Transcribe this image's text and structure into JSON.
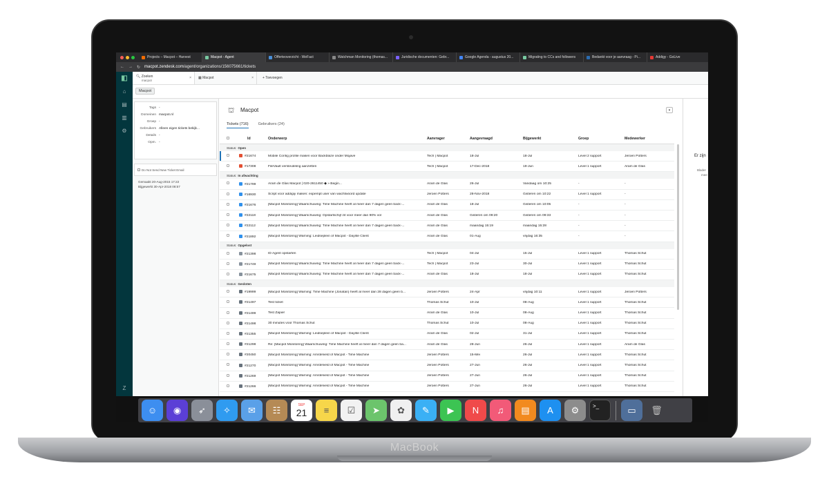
{
  "device": {
    "brand": "MacBook"
  },
  "browser": {
    "tabs": [
      {
        "label": "Projects – Macpot – Harvest",
        "color": "#f36c00"
      },
      {
        "label": "Macpot - Agent",
        "color": "#78c9a1",
        "active": true
      },
      {
        "label": "Offerteoverzicht - WeFact",
        "color": "#4a90d9"
      },
      {
        "label": "Watchman Monitoring (thomas...",
        "color": "#888888"
      },
      {
        "label": "Juridische documenten: Gebr...",
        "color": "#7b61ff"
      },
      {
        "label": "Google Agenda - augustus 20...",
        "color": "#4285f4"
      },
      {
        "label": "Migrating to CCs and followers",
        "color": "#78c9a1"
      },
      {
        "label": "Bedankt voor je aanvraag - Pi...",
        "color": "#2b6cb0"
      },
      {
        "label": "Addigy - GoLive",
        "color": "#e53935"
      }
    ],
    "address_host": "macpot.zendesk.com",
    "address_path": "/agent/organizations/156075661/tickets"
  },
  "zendesk": {
    "tabs": [
      {
        "title": "Zoeken",
        "sub": "macpot"
      },
      {
        "title": "Macpot",
        "sub": ""
      }
    ],
    "add_tab": "+ Toevoegen",
    "breadcrumb": "Macpot",
    "org": {
      "fields": [
        {
          "key": "Tags",
          "value": "-"
        },
        {
          "key": "Domeinen",
          "value": "macpot.nl"
        },
        {
          "key": "Groep",
          "value": "-"
        },
        {
          "key": "Gebruikers",
          "value": "Alleen eigen tickets bekijk..."
        },
        {
          "key": "Details",
          "value": "-"
        },
        {
          "key": "Opm.",
          "value": "-"
        }
      ],
      "checkbox_label": "Do Not Send New Ticket Email",
      "created": "Gemaakt  20-Aug-2015 17:22",
      "updated": "Bijgewerkt  30-Apr-2018 08:57"
    },
    "title": "Macpot",
    "subtabs": [
      "Tickets (716)",
      "Gebruikers (24)"
    ],
    "columns": [
      "Id",
      "Onderwerp",
      "Aanvrager",
      "Aangevraagd",
      "Bijgewerkt",
      "Groep",
      "Medewerker"
    ],
    "status_prefix": "Status:",
    "groups": [
      {
        "status": "Open",
        "color": "#e34f32",
        "rows": [
          [
            "#21674",
            "Mobile Config profile maken voor Backblaze onder Mojave",
            "Tech | Macpot",
            "18-Jul",
            "18-Jul",
            "Level 2 support",
            "Jeroen Potters"
          ],
          [
            "#17308",
            "FileVault versleuteling aanzetten",
            "Tech | Macpot",
            "17-Dec-2018",
            "19-Jun",
            "Level 1 support",
            "Aram de Glas"
          ]
        ]
      },
      {
        "status": "In afwachting",
        "color": "#3091ec",
        "rows": [
          [
            "#21799",
            "Aram de Glas Macpot | 020-2611450 ◆ » Begin...",
            "Aram de Glas",
            "26-Jul",
            "Vandaag om 10:25",
            "-",
            "-"
          ],
          [
            "#16930",
            "Script voor addigiy maken: expempt user van wachtwoord update",
            "Jeroen Potters",
            "28-Nov-2018",
            "Gisteren om 10:22",
            "Level 1 support",
            "-"
          ],
          [
            "#21676",
            "[Macpot Monitoring] Waarschuwing: Time Machine heeft al meer dan 7 dagen geen back-...",
            "Aram de Glas",
            "18-Jul",
            "Gisteren om 10:05",
            "-",
            "-"
          ],
          [
            "#22118",
            "[Macpot Monitoring] Waarschuwing: Opstartschijf zit voor meer dan 90% vol",
            "Aram de Glas",
            "Gisteren om 09:20",
            "Gisteren om 09:33",
            "-",
            "-"
          ],
          [
            "#22112",
            "[Macpot Monitoring] Waarschuwing: Time Machine heeft al meer dan 7 dagen geen back-...",
            "Aram de Glas",
            "maandag 15:19",
            "maandag 15:28",
            "-",
            "-"
          ],
          [
            "#21892",
            "[Macpot Monitoring] Warning: Leidseplein of Macpot - Daylite Client",
            "Aram de Glas",
            "01-Aug",
            "vrijdag 16:35",
            "-",
            "-"
          ]
        ]
      },
      {
        "status": "Opgelost",
        "color": "#87929d",
        "rows": [
          [
            "#21398",
            "ID Agent opstarten",
            "Tech | Macpot",
            "04-Jul",
            "15-Jul",
            "Level 1 support",
            "Thomas Schut"
          ],
          [
            "#21749",
            "[Macpot Monitoring] Waarschuwing: Time Machine heeft al meer dan 7 dagen geen back-...",
            "Tech | Macpot",
            "23-Jul",
            "30-Jul",
            "Level 1 support",
            "Thomas Schut"
          ],
          [
            "#21675",
            "[Macpot Monitoring] Waarschuwing: Time Machine heeft al meer dan 7 dagen geen back-...",
            "Aram de Glas",
            "18-Jul",
            "18-Jul",
            "Level 1 support",
            "Thomas Schut"
          ]
        ]
      },
      {
        "status": "Gesloten",
        "color": "#68737d",
        "rows": [
          [
            "#19999",
            "[Macpot Monitoring] Warning: Time Machine (Jonatan) heeft al meer dan 28 dagen geen b...",
            "Jeroen Potters",
            "24-Apr",
            "vrijdag 10:11",
            "Level 1 support",
            "Jeroen Potters"
          ],
          [
            "#21497",
            "Test ticket",
            "Thomas Schut",
            "10-Jul",
            "08-Aug",
            "Level 1 support",
            "Thomas Schut"
          ],
          [
            "#21499",
            "Test Zapier",
            "Aram de Glas",
            "10-Jul",
            "08-Aug",
            "Level 1 support",
            "Thomas Schut"
          ],
          [
            "#21498",
            "30 minutes voor Thomas Schut",
            "Thomas Schut",
            "10-Jul",
            "08-Aug",
            "Level 1 support",
            "Thomas Schut"
          ],
          [
            "#21355",
            "[Macpot Monitoring] Warning: Leidseplein of Macpot - Daylite Client",
            "Aram de Glas",
            "02-Jul",
            "31-Jul",
            "Level 1 support",
            "Thomas Schut"
          ],
          [
            "#21298",
            "Re: [Macpot Monitoring] Waarschuwing: Time Machine heeft al meer dan 7 dagen geen ba...",
            "Aram de Glas",
            "28-Jun",
            "26-Jul",
            "Level 1 support",
            "Aram de Glas"
          ],
          [
            "#20450",
            "[Macpot Monitoring] Warning: Amstelveld of Macpot - Time Machine",
            "Jeroen Potters",
            "15-Mei",
            "26-Jul",
            "Level 1 support",
            "Thomas Schut"
          ],
          [
            "#21270",
            "[Macpot Monitoring] Warning: Amstelveld of Macpot - Time Machine",
            "Jeroen Potters",
            "27-Jun",
            "26-Jul",
            "Level 1 support",
            "Thomas Schut"
          ],
          [
            "#21269",
            "[Macpot Monitoring] Warning: Amstelveld of Macpot - Time Machine",
            "Jeroen Potters",
            "27-Jun",
            "26-Jul",
            "Level 1 support",
            "Thomas Schut"
          ],
          [
            "#21266",
            "[Macpot Monitoring] Warning: Amstelveld of Macpot - Time Machine",
            "Jeroen Potters",
            "27-Jun",
            "26-Jul",
            "Level 1 support",
            "Thomas Schut"
          ]
        ]
      }
    ],
    "right_panel": {
      "title": "Er zijn",
      "sub1": "Blader",
      "sub2": "mee"
    }
  },
  "dock": {
    "calendar_month": "SEP",
    "calendar_day": "21",
    "apps": [
      {
        "name": "finder-icon",
        "color": "#3d8ef0",
        "glyph": "☺"
      },
      {
        "name": "siri-icon",
        "color": "#5b3fd6",
        "glyph": "◉"
      },
      {
        "name": "launchpad-icon",
        "color": "#8a8f99",
        "glyph": "➶"
      },
      {
        "name": "safari-icon",
        "color": "#2f9bf0",
        "glyph": "✧"
      },
      {
        "name": "mail-icon",
        "color": "#5aa0e8",
        "glyph": "✉"
      },
      {
        "name": "contacts-icon",
        "color": "#b58a55",
        "glyph": "☷"
      },
      {
        "name": "calendar-icon",
        "color": "#ffffff",
        "glyph": ""
      },
      {
        "name": "notes-icon",
        "color": "#f7d64a",
        "glyph": "≡"
      },
      {
        "name": "reminders-icon",
        "color": "#f2f2f2",
        "glyph": "☑"
      },
      {
        "name": "maps-icon",
        "color": "#6cc46c",
        "glyph": "➤"
      },
      {
        "name": "photos-icon",
        "color": "#f0f0f0",
        "glyph": "✿"
      },
      {
        "name": "messages-icon",
        "color": "#3ab0f5",
        "glyph": "✎"
      },
      {
        "name": "facetime-icon",
        "color": "#3cc453",
        "glyph": "▶"
      },
      {
        "name": "news-icon",
        "color": "#f04a4a",
        "glyph": "N"
      },
      {
        "name": "music-icon",
        "color": "#f25a78",
        "glyph": "♫"
      },
      {
        "name": "books-icon",
        "color": "#f28a1f",
        "glyph": "▤"
      },
      {
        "name": "app-store-icon",
        "color": "#1e90f0",
        "glyph": "A"
      },
      {
        "name": "system-preferences-icon",
        "color": "#8c8c8c",
        "glyph": "⚙"
      },
      {
        "name": "terminal-icon",
        "color": "#222222",
        "glyph": ">_"
      }
    ]
  }
}
